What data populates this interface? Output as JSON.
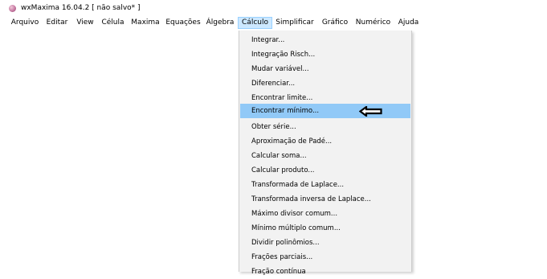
{
  "window": {
    "title": "wxMaxima 16.04.2 [ não salvo* ]"
  },
  "menubar": {
    "items": [
      "Arquivo",
      "Editar",
      "View",
      "Célula",
      "Maxima",
      "Equações",
      "Álgebra",
      "Cálculo",
      "Simplificar",
      "Gráfico",
      "Numérico",
      "Ajuda"
    ],
    "active": "Cálculo"
  },
  "calculo_menu": {
    "items": [
      "Integrar...",
      "Integração Risch...",
      "Mudar variável...",
      "Diferenciar...",
      "Encontrar limite...",
      "Encontrar mínimo...",
      "Obter série...",
      "Aproximação de Padé...",
      "Calcular soma...",
      "Calcular produto...",
      "Transformada de Laplace...",
      "Transformada inversa de Laplace...",
      "Máximo divisor comum...",
      "Mínimo múltiplo comum...",
      "Dividir polinômios...",
      "Frações parciais...",
      "Fração contínua"
    ],
    "highlighted": "Encontrar mínimo..."
  },
  "annotation": {
    "icon": "left-arrow-icon"
  },
  "colors": {
    "highlight": "#91c9f7",
    "active_menu": "#cce8ff",
    "menu_bg": "#f2f2f2"
  }
}
